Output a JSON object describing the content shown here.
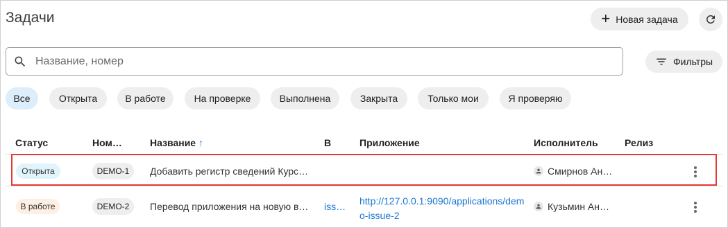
{
  "page": {
    "title": "Задачи"
  },
  "header": {
    "new_task_label": "Новая задача"
  },
  "search": {
    "placeholder": "Название, номер"
  },
  "filters": {
    "label": "Фильтры"
  },
  "status_chips": [
    "Все",
    "Открыта",
    "В работе",
    "На проверке",
    "Выполнена",
    "Закрыта",
    "Только мои",
    "Я проверяю"
  ],
  "table": {
    "columns": {
      "status": "Статус",
      "number": "Ном…",
      "name": "Название",
      "v": "В",
      "app": "Приложение",
      "assignee": "Исполнитель",
      "release": "Релиз"
    },
    "rows": [
      {
        "status": "Открыта",
        "number": "DEMO-1",
        "name": "Добавить регистр сведений Курс…",
        "v": "",
        "app": "",
        "assignee": "Смирнов Ан…",
        "release": ""
      },
      {
        "status": "В работе",
        "number": "DEMO-2",
        "name": "Перевод приложения на новую в…",
        "v": "iss…",
        "app": "http://127.0.0.1:9090/applications/demo-issue-2",
        "assignee": "Кузьмин Ан…",
        "release": ""
      }
    ]
  }
}
